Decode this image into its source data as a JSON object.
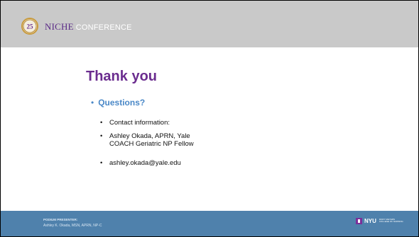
{
  "header": {
    "brand_niche": "NICHE",
    "brand_conference": "CONFERENCE",
    "logo_number": "25"
  },
  "slide": {
    "title": "Thank you",
    "level1_bullet": "Questions?",
    "level2_bullets": [
      "Contact information:",
      "Ashley Okada, APRN, Yale COACH Geriatric NP Fellow",
      "ashley.okada@yale.edu"
    ]
  },
  "footer": {
    "podium_label": "PODIUM PRESENTER:",
    "presenter": "Ashley K. Okada, MSN, APRN, NP-C",
    "nyu_logo_text": "NYU",
    "nyu_sub_line1": "RORY MEYERS",
    "nyu_sub_line2": "COLLEGE OF NURSING"
  },
  "colors": {
    "header_bg": "#c9c9c9",
    "title": "#6b2d8f",
    "bullet_l1": "#4a88c7",
    "footer_bg": "#4f81ac",
    "nyu_purple": "#7a2f99"
  },
  "icons": [
    "niche-25-anniversary-logo",
    "nyu-torch-icon"
  ]
}
